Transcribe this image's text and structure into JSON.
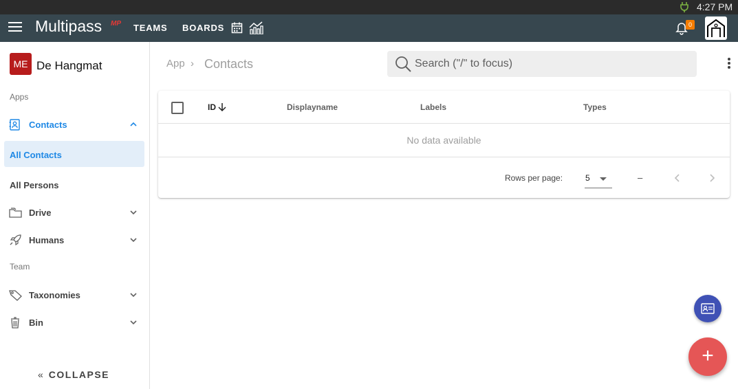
{
  "os": {
    "time": "4:27 PM",
    "status_icon": "charging-plug-icon"
  },
  "appbar": {
    "brand": "Multipass",
    "brand_badge": "MP",
    "nav": [
      "TEAMS",
      "BOARDS"
    ],
    "notification_count": "0",
    "icons": [
      "menu-icon",
      "calendar-icon",
      "chart-icon",
      "bell-icon",
      "home-avatar-icon"
    ]
  },
  "sidebar": {
    "org_initials": "ME",
    "org_name": "De Hangmat",
    "section_apps": "Apps",
    "contacts": "Contacts",
    "contacts_sub": [
      "All Contacts",
      "All Persons"
    ],
    "drive": "Drive",
    "humans": "Humans",
    "section_team": "Team",
    "taxonomies": "Taxonomies",
    "bin": "Bin",
    "collapse_carets": "«",
    "collapse": "COLLAPSE"
  },
  "breadcrumb": {
    "root": "App",
    "separator": "›",
    "current": "Contacts"
  },
  "search": {
    "placeholder": "Search (\"/\" to focus)"
  },
  "table": {
    "columns": [
      "ID",
      "Displayname",
      "Labels",
      "Types"
    ],
    "sort_column": "ID",
    "sort_direction": "descending",
    "empty_text": "No data available",
    "rows_per_page_label": "Rows per page:",
    "rows_per_page": "5",
    "range": "–"
  },
  "colors": {
    "appbar": "#37474f",
    "accent": "#1e88e5",
    "org_avatar": "#b71c1c",
    "fab_primary": "#e55656",
    "fab_secondary": "#3f51b5",
    "badge": "#f57c00"
  }
}
